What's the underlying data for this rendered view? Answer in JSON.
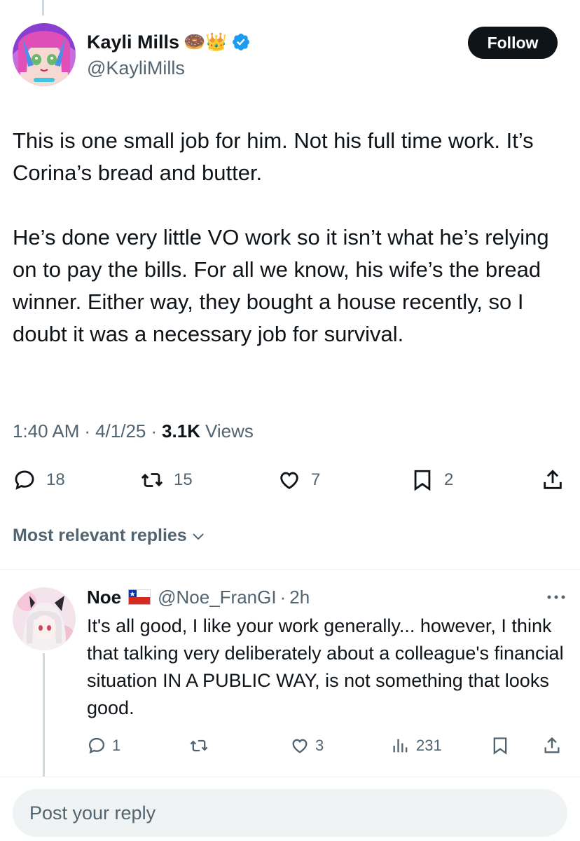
{
  "tweet": {
    "author": {
      "name": "Kayli Mills",
      "emojis": "🍩👑",
      "handle": "@KayliMills",
      "verified": true
    },
    "follow_label": "Follow",
    "paragraphs": [
      "This is one small job for him. Not his full time work. It’s Corina’s bread and butter.",
      "He’s done very little VO work so it isn’t what he’s relying on to pay the bills. For all we know, his wife’s the bread winner. Either way, they bought a house recently, so I doubt it was a necessary job for survival."
    ],
    "time": "1:40 AM",
    "date": "4/1/25",
    "views_count": "3.1K",
    "views_label": "Views",
    "stats": {
      "replies": "18",
      "reposts": "15",
      "likes": "7",
      "bookmarks": "2"
    },
    "icons": [
      "reply-icon",
      "repost-icon",
      "like-icon",
      "bookmark-icon",
      "share-icon"
    ]
  },
  "sort": {
    "label": "Most relevant replies"
  },
  "reply": {
    "name": "Noe",
    "flag": "chile-flag",
    "handle": "@Noe_FranGI",
    "time": "2h",
    "text": "It's all good, I like your work generally... however, I think that talking very deliberately about a colleague's financial situation IN A PUBLIC WAY, is not something that looks good.",
    "stats": {
      "replies": "1",
      "likes": "3",
      "views": "231"
    }
  },
  "composer": {
    "placeholder": "Post your reply"
  },
  "colors": {
    "text_primary": "#0f1419",
    "text_secondary": "#536471",
    "verified_blue": "#1d9bf0",
    "follow_bg": "#0f1419",
    "divider": "#eff3f4",
    "input_bg": "#eff3f4"
  }
}
